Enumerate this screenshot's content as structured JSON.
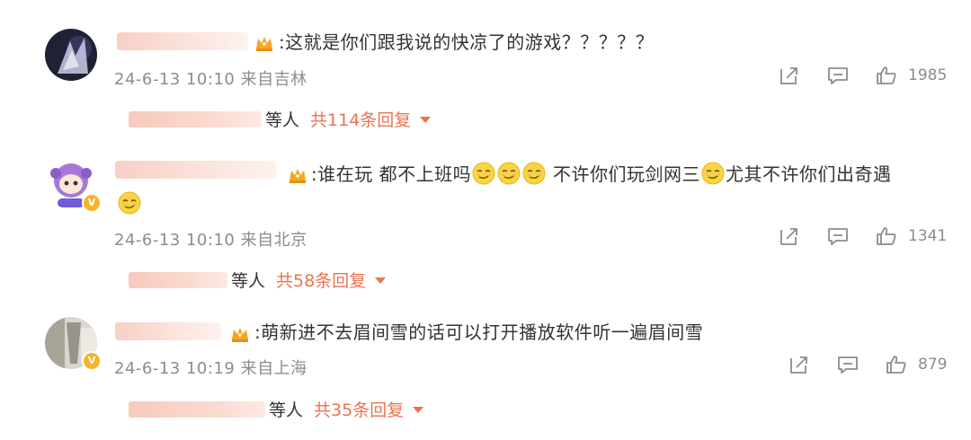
{
  "comments": [
    {
      "text": ":这就是你们跟我说的快凉了的游戏？？？？？",
      "time": "24-6-13 10:10",
      "location": "来自吉林",
      "likes": "1985",
      "reply_suffix": "等人",
      "reply_count": "共114条回复",
      "avatar_icon": "avatar-icon",
      "crown_icon": "crown-icon"
    },
    {
      "text_part1": ":谁在玩 都不上班吗",
      "text_part2": " 不许你们玩剑网三",
      "text_part3": "尤其不许你们出奇遇",
      "time": "24-6-13 10:10",
      "location": "来自北京",
      "likes": "1341",
      "reply_suffix": "等人",
      "reply_count": "共58条回复",
      "avatar_icon": "avatar-icon",
      "crown_icon": "crown-icon",
      "emoji_icon": "smirk-emoji-icon"
    },
    {
      "text": ":萌新进不去眉间雪的话可以打开播放软件听一遍眉间雪",
      "time": "24-6-13 10:19",
      "location": "来自上海",
      "likes": "879",
      "reply_suffix": "等人",
      "reply_count": "共35条回复",
      "avatar_icon": "avatar-icon",
      "crown_icon": "crown-icon"
    }
  ],
  "icons": {
    "share": "share-icon",
    "comment": "comment-icon",
    "like": "like-icon",
    "verified": "verified-badge-icon",
    "caret": "caret-down-icon"
  },
  "verified_mark": "V",
  "colors": {
    "text": "#333333",
    "meta": "#8c8c8c",
    "reply_accent": "#eb7350",
    "crown": "#f5a623",
    "emoji": "#f9d442",
    "verified": "#f5b52a"
  }
}
